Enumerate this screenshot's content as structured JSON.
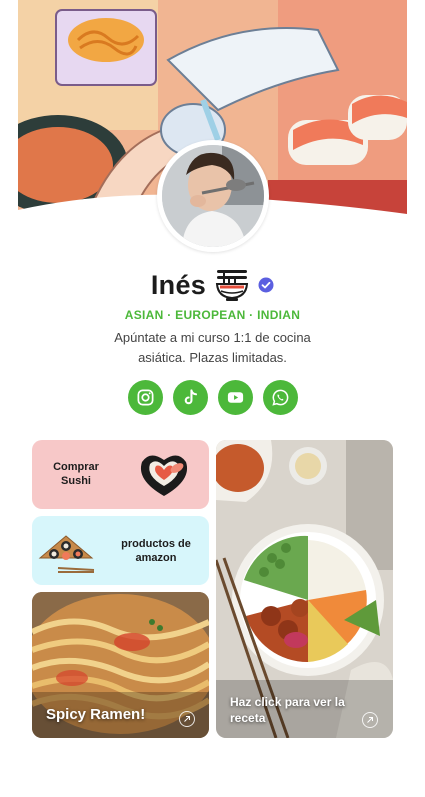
{
  "profile": {
    "name": "Inés",
    "tagline": "ASIAN · EUROPEAN · INDIAN",
    "bio": "Apúntate a mi curso 1:1 de cocina asiática. Plazas limitadas.",
    "icons": {
      "name_emoji": "noodle-bowl-icon",
      "verified": "verified-badge-icon"
    }
  },
  "socials": [
    {
      "name": "instagram",
      "icon": "instagram-icon"
    },
    {
      "name": "tiktok",
      "icon": "tiktok-icon"
    },
    {
      "name": "youtube",
      "icon": "youtube-icon"
    },
    {
      "name": "whatsapp",
      "icon": "whatsapp-icon"
    }
  ],
  "links": [
    {
      "label": "Comprar Sushi",
      "image": "sushi-heart-icon"
    },
    {
      "label": "productos de amazon",
      "image": "sushi-tray-icon"
    },
    {
      "label": "Spicy Ramen!",
      "image": "ramen-photo"
    },
    {
      "label": "Haz click para ver la receta",
      "image": "poke-bowl-photo"
    }
  ],
  "colors": {
    "accent": "#4cb83a",
    "card_pink": "#f7c8c8",
    "card_blue": "#d7f6fb",
    "verified": "#5b5fe0"
  }
}
